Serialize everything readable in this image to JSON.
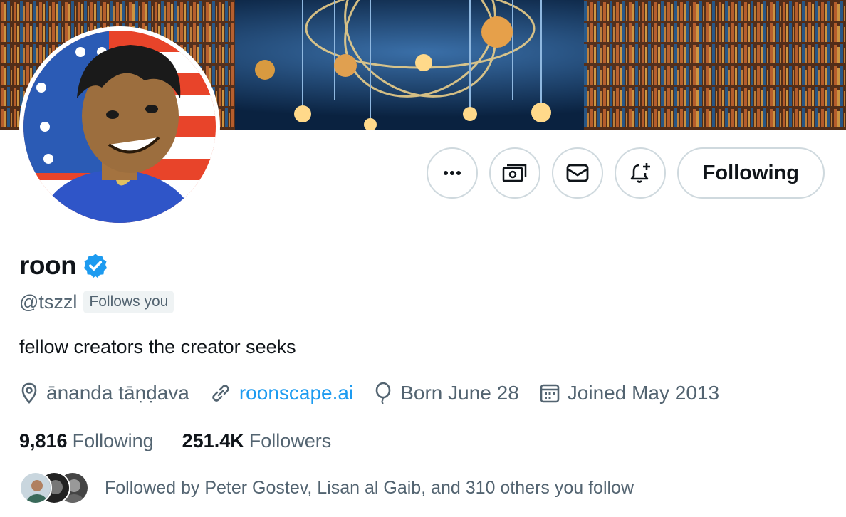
{
  "profile": {
    "display_name": "roon",
    "handle": "@tszzl",
    "follows_you_badge": "Follows you",
    "bio": "fellow creators the creator seeks",
    "location": "ānanda tāṇḍava",
    "website": "roonscape.ai",
    "birthday": "Born June 28",
    "joined": "Joined May 2013"
  },
  "actions": {
    "more": "more-icon",
    "subscribe": "money-icon",
    "message": "envelope-icon",
    "notify": "bell-plus-icon",
    "follow_label": "Following"
  },
  "stats": {
    "following_count": "9,816",
    "following_label": "Following",
    "followers_count": "251.4K",
    "followers_label": "Followers"
  },
  "followed_by": {
    "text": "Followed by Peter Gostev, Lisan al Gaib, and 310 others you follow"
  },
  "colors": {
    "accent": "#1d9bf0",
    "muted": "#536471",
    "border": "#cfd9de",
    "badge_bg": "#eff3f4"
  }
}
